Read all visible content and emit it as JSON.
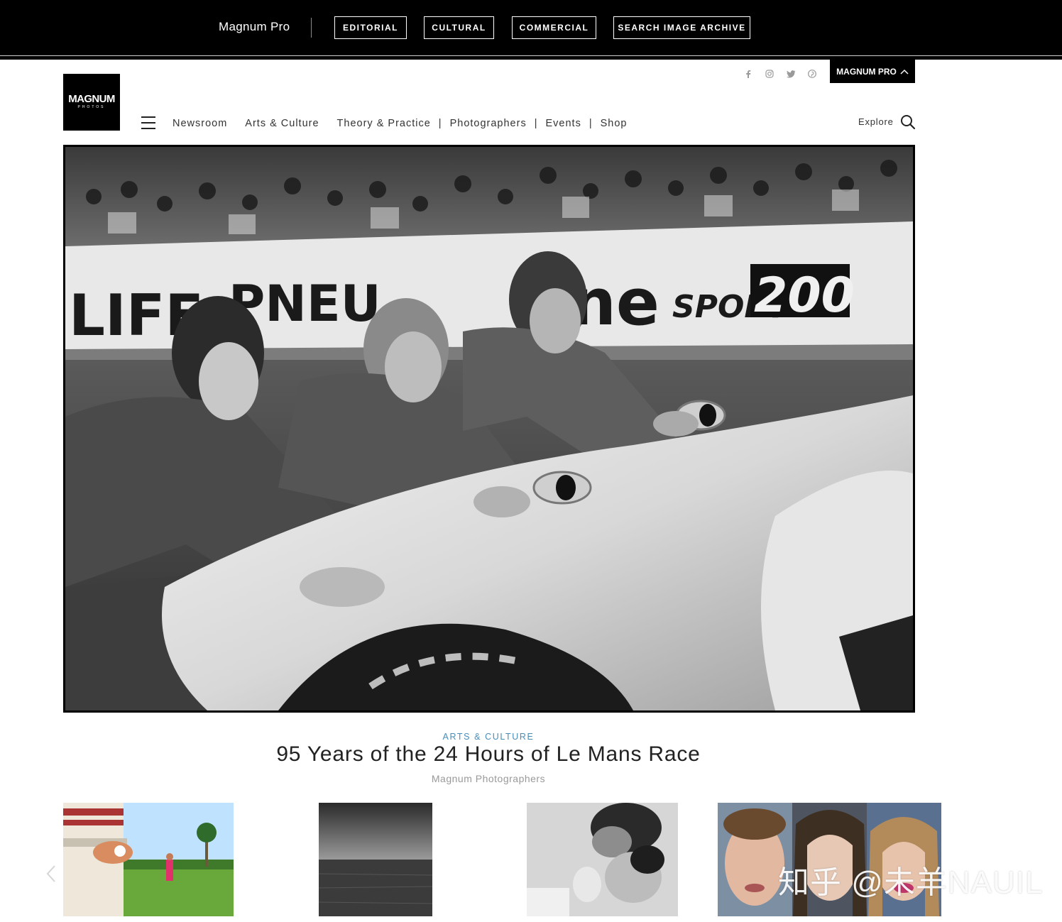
{
  "pro_bar": {
    "brand": "Magnum Pro",
    "buttons": [
      "EDITORIAL",
      "CULTURAL",
      "COMMERCIAL",
      "SEARCH IMAGE ARCHIVE"
    ]
  },
  "header": {
    "logo_main": "MAGNUM",
    "logo_sub": "PHOTOS",
    "social_icons": [
      "facebook-icon",
      "instagram-icon",
      "twitter-icon",
      "pinterest-icon"
    ],
    "pro_toggle": "MAGNUM PRO",
    "nav": [
      "Newsroom",
      "Arts & Culture",
      "Theory & Practice",
      "Photographers",
      "Events",
      "Shop"
    ],
    "explore_label": "Explore"
  },
  "hero": {
    "category": "ARTS & CULTURE",
    "title": "95 Years of the 24 Hours of Le Mans Race",
    "author": "Magnum Photographers",
    "banner_texts": [
      "LIFE",
      "PNEU",
      "one",
      "SPORT",
      "200"
    ]
  },
  "watermark": "知乎 @未羊NAUIL",
  "colors": {
    "category_accent": "#4a8cb8",
    "black": "#000000"
  }
}
